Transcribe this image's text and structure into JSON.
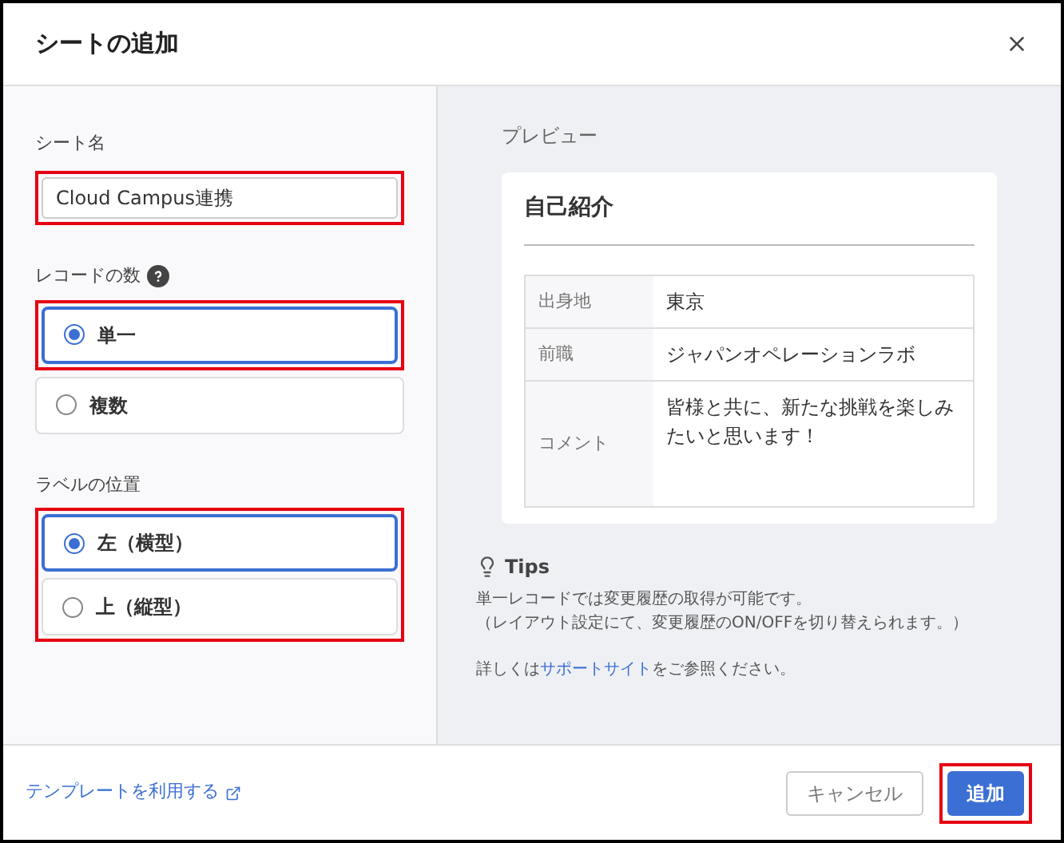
{
  "dialog": {
    "title": "シートの追加"
  },
  "form": {
    "sheet_name": {
      "label": "シート名",
      "value": "Cloud Campus連携",
      "highlighted": true
    },
    "record_count": {
      "label": "レコードの数",
      "highlighted": false,
      "options": [
        {
          "label": "単一",
          "selected": true,
          "highlighted": true
        },
        {
          "label": "複数",
          "selected": false,
          "highlighted": false
        }
      ]
    },
    "label_position": {
      "label": "ラベルの位置",
      "highlighted": true,
      "options": [
        {
          "label": "左（横型）",
          "selected": true,
          "highlighted": false
        },
        {
          "label": "上（縦型）",
          "selected": false,
          "highlighted": false
        }
      ]
    }
  },
  "preview": {
    "heading": "プレビュー",
    "card_title": "自己紹介",
    "rows": [
      {
        "label": "出身地",
        "value": "東京"
      },
      {
        "label": "前職",
        "value": "ジャパンオペレーションラボ"
      },
      {
        "label": "コメント",
        "value": "皆様と共に、新たな挑戦を楽しみたいと思います！"
      }
    ]
  },
  "tips": {
    "title": "Tips",
    "lines": [
      "単一レコードでは変更履歴の取得が可能です。",
      "（レイアウト設定にて、変更履歴のON/OFFを切り替えられます。）"
    ],
    "note_before": "詳しくは",
    "link": "サポートサイト",
    "note_after": "をご参照ください。"
  },
  "footer": {
    "template_link": "テンプレートを利用する",
    "cancel": "キャンセル",
    "submit": "追加",
    "submit_highlighted": true
  }
}
